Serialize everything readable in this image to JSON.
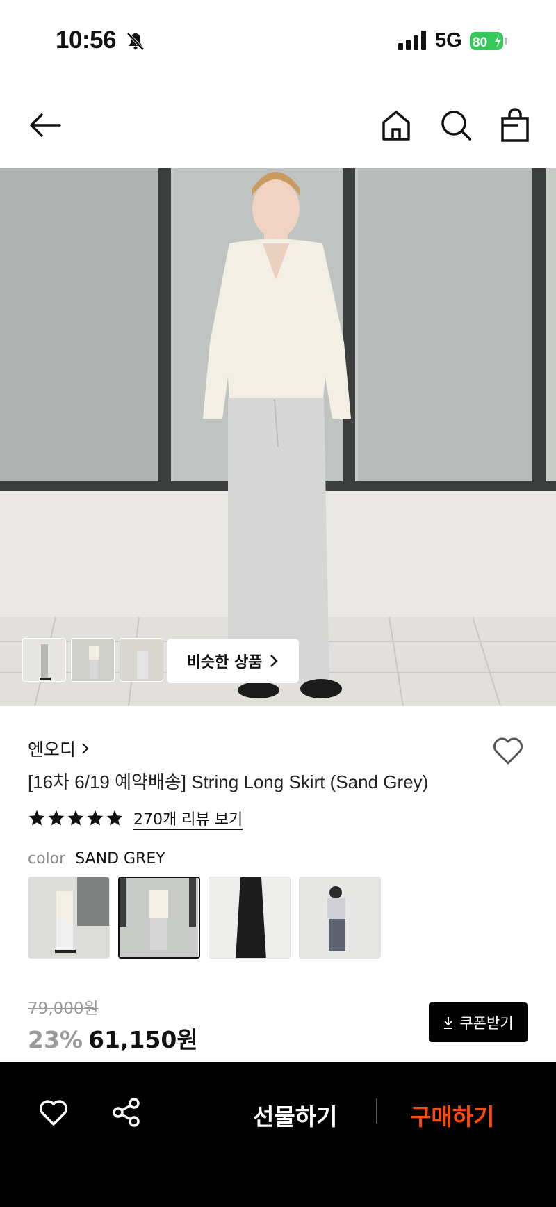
{
  "status_bar": {
    "time": "10:56",
    "network": "5G",
    "battery": "80"
  },
  "nav": {
    "icons": [
      "back-arrow-icon",
      "home-icon",
      "search-icon",
      "shopping-bag-icon"
    ]
  },
  "hero": {
    "similar_products_label": "비슷한 상품"
  },
  "product": {
    "brand": "엔오디",
    "title": "[16차 6/19 예약배송] String Long Skirt (Sand Grey)",
    "rating_stars": 5,
    "review_link": "270개 리뷰 보기",
    "color_label": "color",
    "color_value": "SAND GREY",
    "original_price": "79,000원",
    "discount": "23%",
    "price": "61,150원",
    "coupon_label": "쿠폰받기"
  },
  "bottom_bar": {
    "gift_label": "선물하기",
    "buy_label": "구매하기"
  },
  "colors": {
    "accent": "#ff4b0a",
    "bottom_bar_bg": "#000000"
  }
}
